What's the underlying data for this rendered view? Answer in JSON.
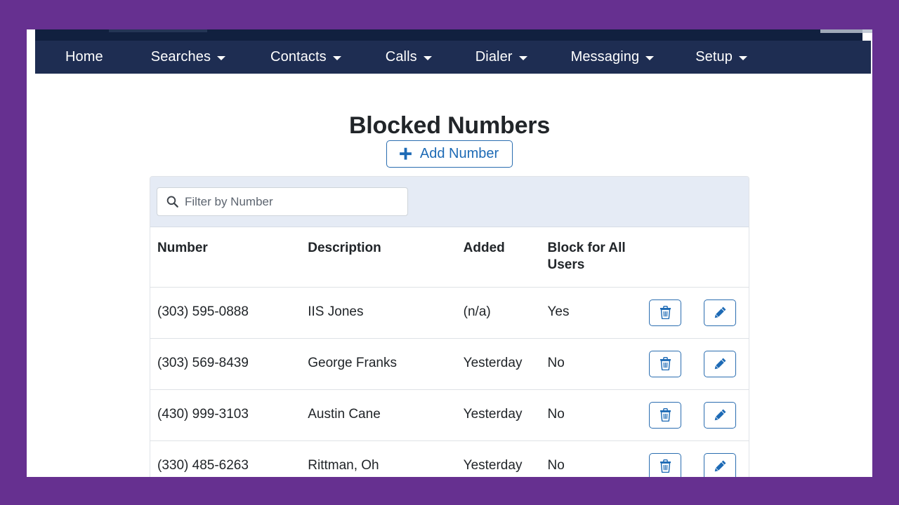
{
  "theme": {
    "frame_color": "#663090",
    "navbar_color": "#1e2d52",
    "topstrip_color": "#11203f",
    "accent_blue": "#1d6ab5",
    "filter_bar_bg": "#e5ebf5",
    "text_color": "#212529"
  },
  "nav": {
    "items": [
      {
        "label": "Home",
        "has_dropdown": false
      },
      {
        "label": "Searches",
        "has_dropdown": true
      },
      {
        "label": "Contacts",
        "has_dropdown": true
      },
      {
        "label": "Calls",
        "has_dropdown": true
      },
      {
        "label": "Dialer",
        "has_dropdown": true
      },
      {
        "label": "Messaging",
        "has_dropdown": true
      },
      {
        "label": "Setup",
        "has_dropdown": true
      }
    ]
  },
  "main": {
    "title": "Blocked Numbers",
    "add_button": {
      "label": "Add Number",
      "icon": "plus-icon"
    },
    "filter": {
      "placeholder": "Filter by Number",
      "value": "",
      "icon": "search-icon"
    },
    "table": {
      "columns": [
        "Number",
        "Description",
        "Added",
        "Block for All Users",
        ""
      ],
      "rows": [
        {
          "number": "(303) 595-0888",
          "description": "IIS Jones",
          "added": "(n/a)",
          "block_for_all_users": "Yes"
        },
        {
          "number": "(303) 569-8439",
          "description": "George Franks",
          "added": "Yesterday",
          "block_for_all_users": "No"
        },
        {
          "number": "(430) 999-3103",
          "description": "Austin Cane",
          "added": "Yesterday",
          "block_for_all_users": "No"
        },
        {
          "number": "(330) 485-6263",
          "description": "Rittman, Oh",
          "added": "Yesterday",
          "block_for_all_users": "No"
        }
      ],
      "row_actions": [
        {
          "icon": "trash-icon",
          "name": "delete-row-button"
        },
        {
          "icon": "pencil-icon",
          "name": "edit-row-button"
        }
      ]
    }
  }
}
